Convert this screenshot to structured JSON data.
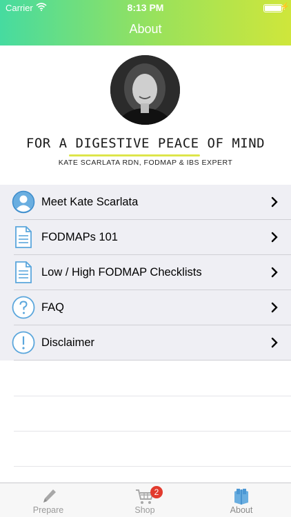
{
  "status_bar": {
    "carrier": "Carrier",
    "time": "8:13 PM"
  },
  "nav": {
    "title": "About"
  },
  "hero": {
    "tagline": "FOR A DIGESTIVE PEACE OF MIND",
    "subtagline": "KATE SCARLATA RDN, FODMAP & IBS EXPERT"
  },
  "menu": {
    "items": [
      {
        "label": "Meet Kate Scarlata",
        "icon": "person-icon"
      },
      {
        "label": "FODMAPs 101",
        "icon": "document-icon"
      },
      {
        "label": "Low / High FODMAP Checklists",
        "icon": "document-icon"
      },
      {
        "label": "FAQ",
        "icon": "question-icon"
      },
      {
        "label": "Disclaimer",
        "icon": "exclamation-icon"
      }
    ]
  },
  "tabs": [
    {
      "label": "Prepare",
      "icon": "pencil-icon"
    },
    {
      "label": "Shop",
      "icon": "cart-icon",
      "badge": "2"
    },
    {
      "label": "About",
      "icon": "books-icon",
      "active": true
    }
  ],
  "colors": {
    "header_gradient_start": "#46dba0",
    "header_gradient_end": "#cfe63b",
    "icon_blue": "#5aa6dc",
    "menu_bg": "#efeff4",
    "badge_red": "#e23b2e"
  }
}
